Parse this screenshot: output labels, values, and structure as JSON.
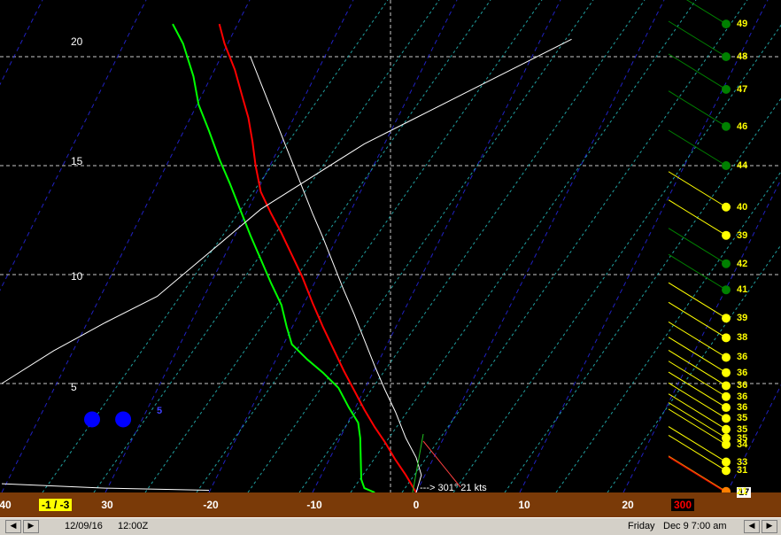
{
  "chart_data": {
    "type": "line",
    "x_label_ticks": [
      "30",
      "-20",
      "-10",
      "0",
      "10",
      "20"
    ],
    "y_ticks": [
      "5",
      "10",
      "15",
      "20"
    ],
    "x_range": [
      -40,
      20
    ],
    "y_range": [
      0,
      21
    ],
    "series": [
      {
        "name": "temperature",
        "color": "#ff0000",
        "points": [
          [
            0,
            0
          ],
          [
            -1,
            0.8
          ],
          [
            -2,
            1.5
          ],
          [
            -3,
            2.3
          ],
          [
            -4,
            3
          ],
          [
            -5,
            3.8
          ],
          [
            -6,
            4.7
          ],
          [
            -7,
            5.6
          ],
          [
            -8,
            6.6
          ],
          [
            -9,
            7.6
          ],
          [
            -10,
            8.7
          ],
          [
            -11,
            9.9
          ],
          [
            -12,
            10.9
          ],
          [
            -13,
            11.9
          ],
          [
            -14,
            12.8
          ],
          [
            -15,
            13.8
          ],
          [
            -15.5,
            15
          ],
          [
            -15.8,
            16.1
          ],
          [
            -16.2,
            17.2
          ],
          [
            -16.8,
            18.2
          ],
          [
            -17.5,
            19.4
          ],
          [
            -18.5,
            20.6
          ],
          [
            -19,
            21.5
          ]
        ]
      },
      {
        "name": "dewpoint",
        "color": "#00ff00",
        "points": [
          [
            -4,
            0
          ],
          [
            -5,
            0.2
          ],
          [
            -5.3,
            0.6
          ],
          [
            -5.4,
            2.5
          ],
          [
            -5.6,
            3.2
          ],
          [
            -6.5,
            3.9
          ],
          [
            -7.5,
            4.8
          ],
          [
            -9,
            5.5
          ],
          [
            -10.5,
            6.1
          ],
          [
            -12,
            6.8
          ],
          [
            -12.5,
            7.6
          ],
          [
            -13,
            8.6
          ],
          [
            -14,
            9.6
          ],
          [
            -15,
            10.7
          ],
          [
            -16,
            11.8
          ],
          [
            -17,
            13
          ],
          [
            -18,
            14.2
          ],
          [
            -19,
            15.3
          ],
          [
            -20,
            16.6
          ],
          [
            -21,
            17.8
          ],
          [
            -21.5,
            19.1
          ],
          [
            -22.5,
            20.6
          ],
          [
            -23.5,
            21.5
          ]
        ]
      },
      {
        "name": "parcel",
        "color": "#ffffff",
        "points": [
          [
            0,
            0
          ],
          [
            0.5,
            0.8
          ],
          [
            0,
            1.6
          ],
          [
            -1,
            2.5
          ],
          [
            -2,
            3.7
          ],
          [
            -3,
            4.7
          ],
          [
            -4,
            5.8
          ],
          [
            -5,
            7
          ],
          [
            -6,
            8.2
          ],
          [
            -7,
            9.3
          ],
          [
            -8,
            10.5
          ],
          [
            -9,
            11.7
          ],
          [
            -10,
            12.8
          ],
          [
            -11,
            14
          ],
          [
            -12,
            15.2
          ],
          [
            -13,
            16.4
          ],
          [
            -14,
            17.6
          ],
          [
            -15,
            18.8
          ],
          [
            -16,
            20
          ]
        ]
      },
      {
        "name": "upper-curve",
        "color": "#ffffff",
        "points": [
          [
            -40,
            5
          ],
          [
            -35,
            6.5
          ],
          [
            -30,
            7.8
          ],
          [
            -25,
            9
          ],
          [
            -20,
            11
          ],
          [
            -15,
            13
          ],
          [
            -10,
            14.5
          ],
          [
            -5,
            16
          ],
          [
            0,
            17.2
          ],
          [
            5,
            18.4
          ],
          [
            10,
            19.6
          ],
          [
            15,
            20.8
          ]
        ]
      },
      {
        "name": "surface-curve",
        "color": "#ffffff",
        "points": [
          [
            -40,
            0.4
          ],
          [
            -30,
            0.2
          ],
          [
            -20,
            0.1
          ]
        ]
      }
    ],
    "wind_profile": [
      {
        "alt": 0,
        "speed": "17",
        "color": "#ff0000"
      },
      {
        "alt": 0.05,
        "speed": "21",
        "color": "#ff8000"
      },
      {
        "alt": 1,
        "speed": "31",
        "color": "#ffff00"
      },
      {
        "alt": 1.4,
        "speed": "33",
        "color": "#ffff00"
      },
      {
        "alt": 2.2,
        "speed": "34",
        "color": "#ffff00"
      },
      {
        "alt": 2.5,
        "speed": "35",
        "color": "#ffff00"
      },
      {
        "alt": 2.9,
        "speed": "35",
        "color": "#ffff00"
      },
      {
        "alt": 3.4,
        "speed": "35",
        "color": "#ffff00"
      },
      {
        "alt": 3.9,
        "speed": "36",
        "color": "#ffff00"
      },
      {
        "alt": 4.4,
        "speed": "36",
        "color": "#ffff00"
      },
      {
        "alt": 4.9,
        "speed": "36",
        "color": "#ffff00"
      },
      {
        "alt": 5.5,
        "speed": "36",
        "color": "#ffff00"
      },
      {
        "alt": 6.2,
        "speed": "36",
        "color": "#ffff00"
      },
      {
        "alt": 7.1,
        "speed": "38",
        "color": "#ffff00"
      },
      {
        "alt": 8.0,
        "speed": "39",
        "color": "#ffff00"
      },
      {
        "alt": 9.3,
        "speed": "41",
        "color": "#008000"
      },
      {
        "alt": 10.5,
        "speed": "42",
        "color": "#008000"
      },
      {
        "alt": 11.8,
        "speed": "39",
        "color": "#ffff00"
      },
      {
        "alt": 13.1,
        "speed": "40",
        "color": "#ffff00"
      },
      {
        "alt": 15.0,
        "speed": "44",
        "color": "#008000"
      },
      {
        "alt": 16.8,
        "speed": "46",
        "color": "#008000"
      },
      {
        "alt": 18.5,
        "speed": "47",
        "color": "#008000"
      },
      {
        "alt": 20.0,
        "speed": "48",
        "color": "#008000"
      },
      {
        "alt": 21.5,
        "speed": "49",
        "color": "#008000"
      }
    ],
    "markers": [
      {
        "x": -30,
        "y": 3.6,
        "color": "#0000ff"
      },
      {
        "x": -27,
        "y": 3.6,
        "color": "#0000ff"
      }
    ],
    "marker_label": "5",
    "surface_wind": "--->  301° 21 kts",
    "temp_box": "-1 / -3",
    "pressure_box": "300",
    "x_left_label": "40"
  },
  "status": {
    "date": "12/09/16",
    "time": "12:00Z",
    "day": "Friday",
    "local": "Dec 9  7:00 am"
  },
  "icons": {
    "prev": "left-arrow-icon",
    "next": "right-arrow-icon"
  }
}
